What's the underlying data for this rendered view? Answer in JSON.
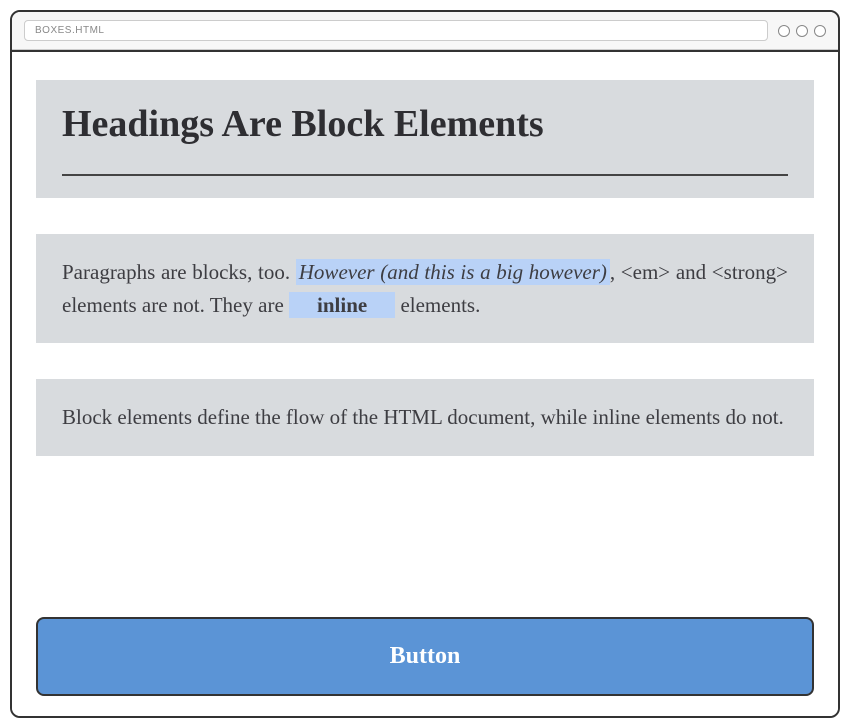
{
  "address_bar": "BOXES.HTML",
  "heading": "Headings Are Block Elements",
  "paragraph1": {
    "pre": "Paragraphs are blocks, too. ",
    "em": "However (and this is a big however)",
    "mid": ", <em> and <strong> elements are not. They are ",
    "strong": "inline",
    "post": " elements."
  },
  "paragraph2": "Block elements define the flow of the HTML document, while inline elements do not.",
  "button_label": "Button"
}
